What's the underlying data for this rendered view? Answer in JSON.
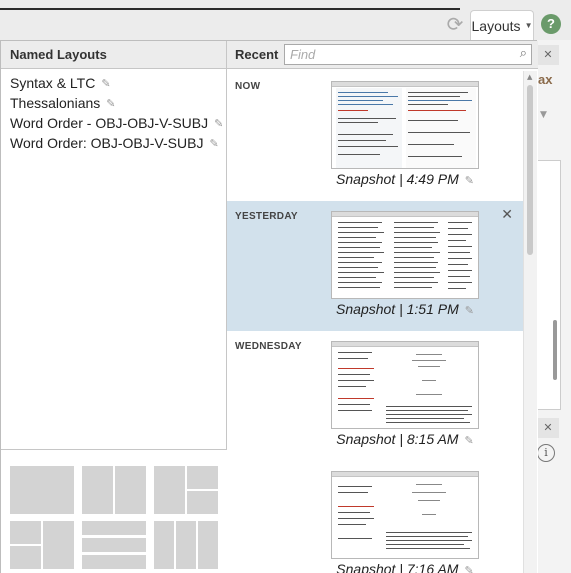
{
  "toolbar": {
    "layouts_label": "Layouts",
    "help_label": "?"
  },
  "background": {
    "fragment_text": "ax"
  },
  "named_layouts": {
    "title": "Named Layouts",
    "items": [
      {
        "label": "Syntax & LTC"
      },
      {
        "label": "Thessalonians"
      },
      {
        "label": "Word Order - OBJ-OBJ-V-SUBJ"
      },
      {
        "label": "Word Order: OBJ-OBJ-V-SUBJ"
      }
    ]
  },
  "recent": {
    "title": "Recent",
    "search_placeholder": "Find",
    "entries": [
      {
        "day": "NOW",
        "caption": "Snapshot | 4:49 PM",
        "selected": false
      },
      {
        "day": "YESTERDAY",
        "caption": "Snapshot | 1:51 PM",
        "selected": true
      },
      {
        "day": "WEDNESDAY",
        "caption": "Snapshot | 8:15 AM",
        "selected": false
      },
      {
        "day": "",
        "caption": "Snapshot | 7:16 AM",
        "selected": false
      }
    ]
  },
  "colors": {
    "selected_row": "#d2e1ec",
    "template_block": "#d3d3d3",
    "help_icon": "#6a9a6a"
  }
}
